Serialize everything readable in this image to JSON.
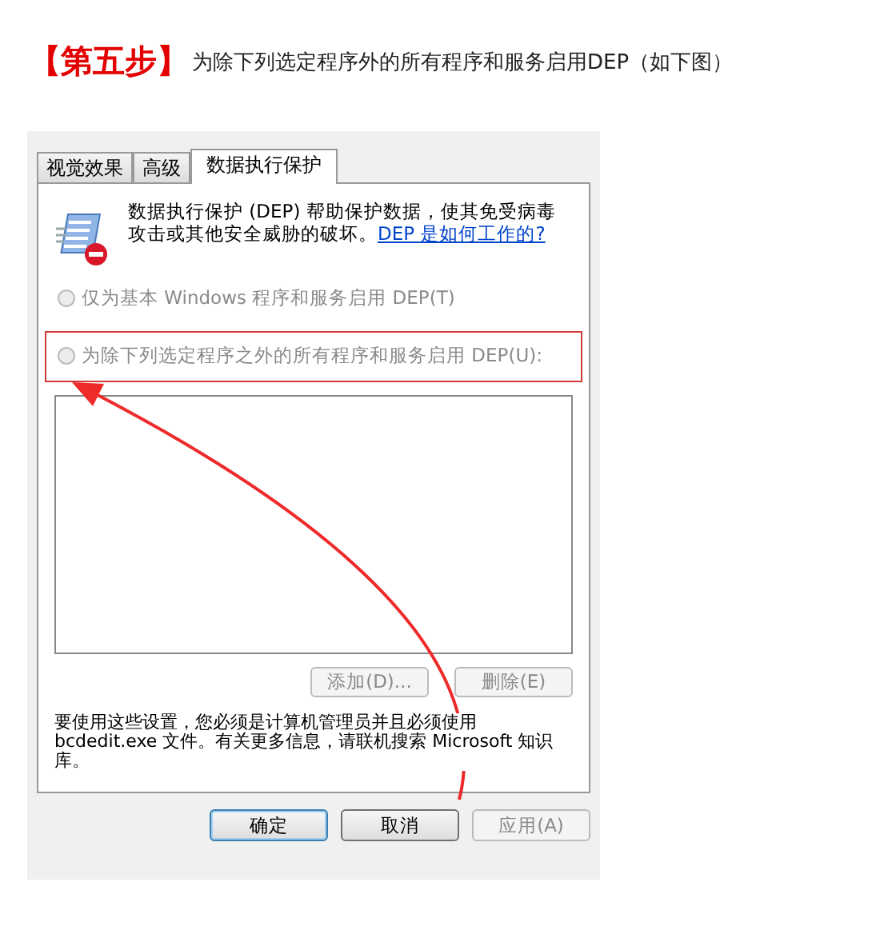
{
  "heading": {
    "step": "【第五步】",
    "text": "为除下列选定程序外的所有程序和服务启用DEP（如下图）"
  },
  "dialog": {
    "tabs": [
      {
        "label": "视觉效果",
        "selected": false
      },
      {
        "label": "高级",
        "selected": false
      },
      {
        "label": "数据执行保护",
        "selected": true
      }
    ],
    "description": "数据执行保护 (DEP) 帮助保护数据，使其免受病毒攻击或其他安全威胁的破坏。",
    "link": "DEP 是如何工作的?",
    "options": [
      {
        "label": "仅为基本 Windows 程序和服务启用 DEP(T)",
        "selected": false,
        "disabled": true,
        "highlighted": false
      },
      {
        "label": "为除下列选定程序之外的所有程序和服务启用 DEP(U):",
        "selected": false,
        "disabled": true,
        "highlighted": true
      }
    ],
    "list_buttons": [
      {
        "label": "添加(D)...",
        "disabled": true
      },
      {
        "label": "删除(E)",
        "disabled": true
      }
    ],
    "note": "要使用这些设置，您必须是计算机管理员并且必须使用 bcdedit.exe 文件。有关更多信息，请联机搜索 Microsoft 知识库。",
    "buttons": [
      {
        "label": "确定",
        "default": true,
        "disabled": false
      },
      {
        "label": "取消",
        "default": false,
        "disabled": false
      },
      {
        "label": "应用(A)",
        "default": false,
        "disabled": true
      }
    ]
  }
}
